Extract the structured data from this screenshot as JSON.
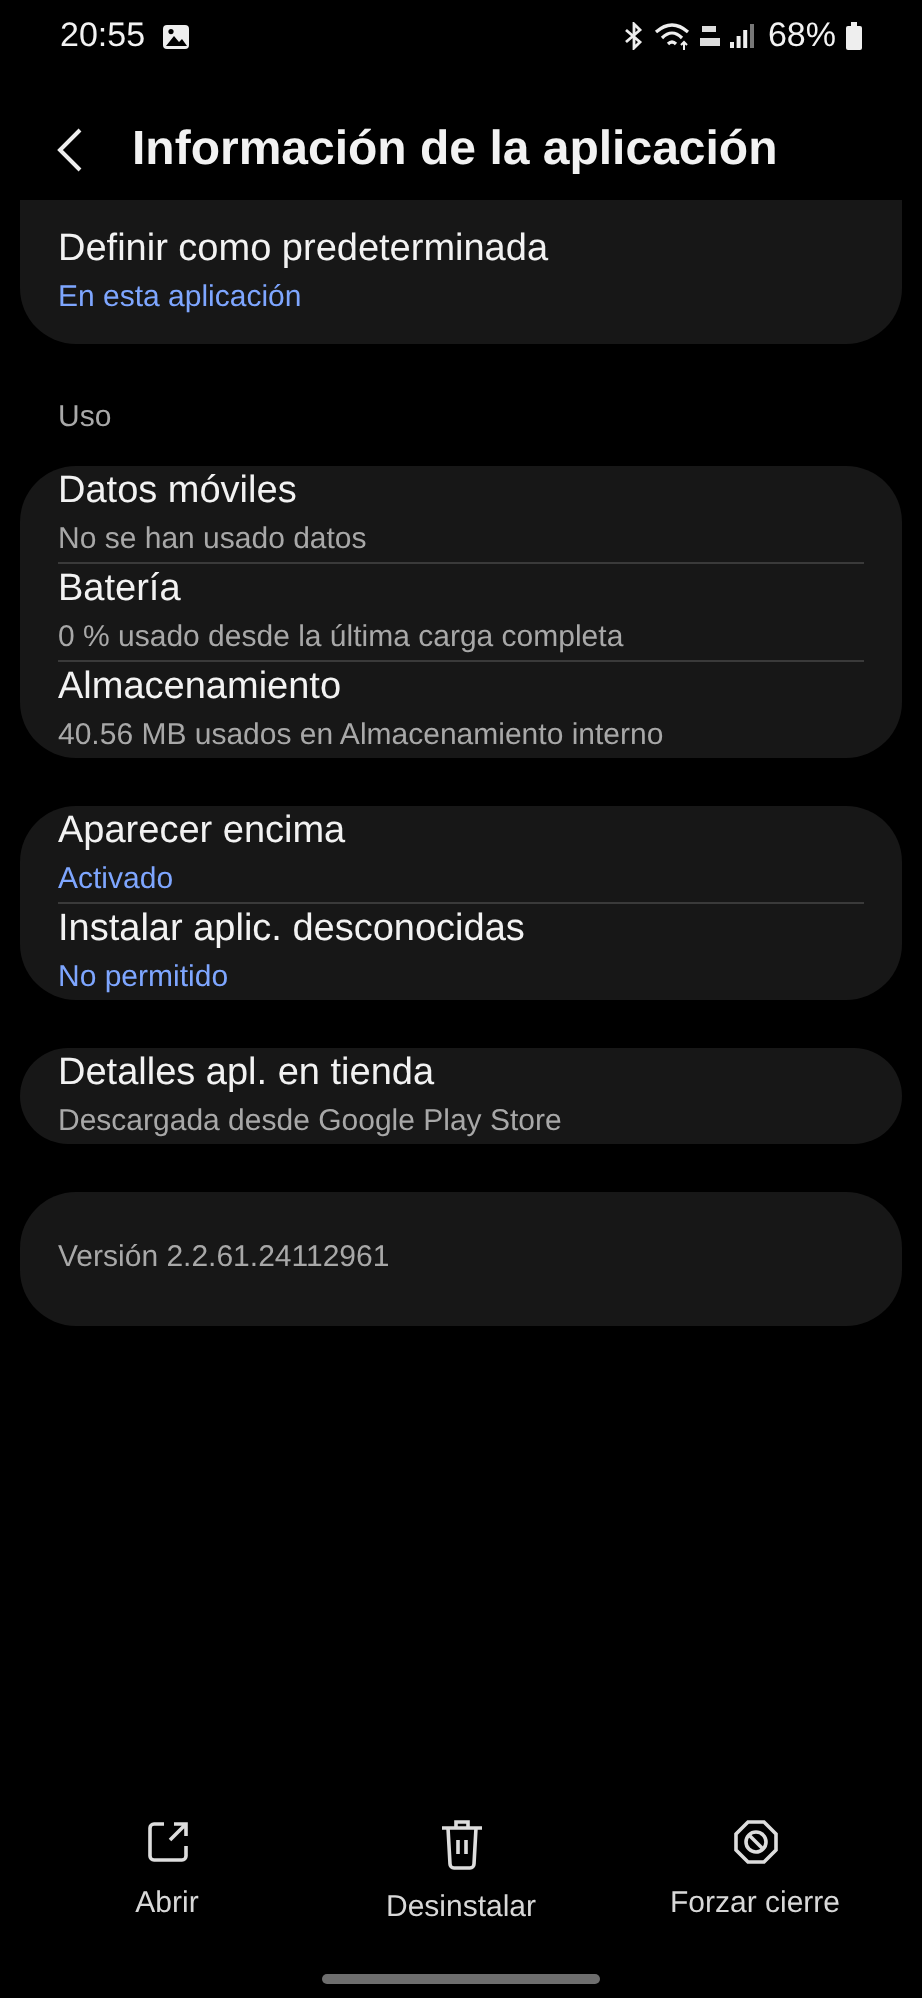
{
  "status_bar": {
    "time": "20:55",
    "battery": "68%"
  },
  "header": {
    "title": "Información de la aplicación"
  },
  "sections": [
    {
      "cards": [
        {
          "items": [
            {
              "title": "Definir como predeterminada",
              "subtitle": "En esta aplicación",
              "kind": "accent"
            }
          ]
        }
      ]
    },
    {
      "label": "Uso",
      "cards": [
        {
          "items": [
            {
              "title": "Datos móviles",
              "subtitle": "No se han usado datos",
              "kind": "plain"
            },
            {
              "title": "Batería",
              "subtitle": "0 % usado desde la última carga completa",
              "kind": "plain"
            },
            {
              "title": "Almacenamiento",
              "subtitle": "40.56 MB usados en Almacenamiento interno",
              "kind": "plain"
            }
          ]
        },
        {
          "items": [
            {
              "title": "Aparecer encima",
              "subtitle": "Activado",
              "kind": "accent"
            },
            {
              "title": "Instalar aplic. desconocidas",
              "subtitle": "No permitido",
              "kind": "accent"
            }
          ]
        },
        {
          "items": [
            {
              "title": "Detalles apl. en tienda",
              "subtitle": "Descargada desde Google Play Store",
              "kind": "plain"
            }
          ]
        }
      ]
    }
  ],
  "version": "Versión 2.2.61.24112961",
  "actions": [
    {
      "label": "Abrir",
      "kind": "open"
    },
    {
      "label": "Desinstalar",
      "kind": "uninstall"
    },
    {
      "label": "Forzar cierre",
      "kind": "stop"
    }
  ]
}
